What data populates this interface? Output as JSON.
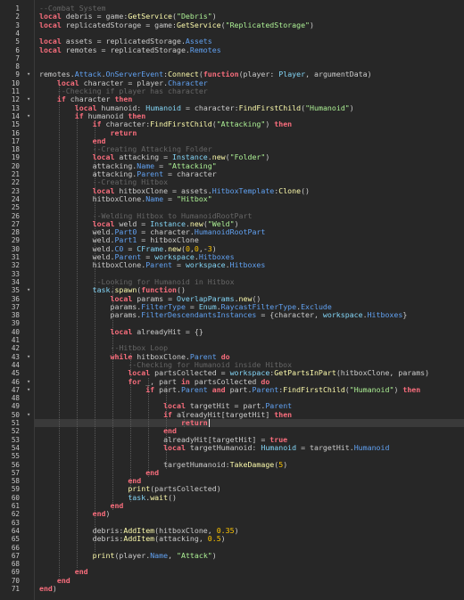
{
  "editor": {
    "line_numbers": [
      "1",
      "2",
      "3",
      "4",
      "5",
      "6",
      "7",
      "8",
      "9",
      "10",
      "11",
      "12",
      "13",
      "14",
      "15",
      "16",
      "17",
      "18",
      "19",
      "20",
      "21",
      "22",
      "23",
      "24",
      "25",
      "26",
      "27",
      "28",
      "29",
      "30",
      "31",
      "32",
      "33",
      "34",
      "35",
      "36",
      "37",
      "38",
      "39",
      "40",
      "41",
      "42",
      "43",
      "44",
      "45",
      "46",
      "47",
      "48",
      "49",
      "50",
      "51",
      "52",
      "53",
      "54",
      "55",
      "56",
      "57",
      "58",
      "59",
      "60",
      "61",
      "62",
      "63",
      "64",
      "65",
      "66",
      "67",
      "68",
      "69",
      "70",
      "71"
    ],
    "fold_glyph": "▾",
    "fold_lines": [
      9,
      12,
      14,
      35,
      43,
      46,
      47,
      50
    ],
    "current_line": 51,
    "colors": {
      "background": "#272727",
      "keyword": "#f86d7c",
      "function": "#fdfbac",
      "string": "#adf195",
      "number": "#ffc600",
      "comment": "#666666",
      "property": "#61a1f1",
      "builtin": "#84d6f7",
      "text": "#cccccc",
      "current_line": "#3a3a3a"
    },
    "lines": [
      [
        [
          "cm",
          "--Combat System"
        ]
      ],
      [
        [
          "kw",
          "local"
        ],
        [
          "id",
          " debris = game:"
        ],
        [
          "fn",
          "GetService"
        ],
        [
          "id",
          "("
        ],
        [
          "str",
          "\"Debris\""
        ],
        [
          "id",
          ")"
        ]
      ],
      [
        [
          "kw",
          "local"
        ],
        [
          "id",
          " replicatedStorage = game:"
        ],
        [
          "fn",
          "GetService"
        ],
        [
          "id",
          "("
        ],
        [
          "str",
          "\"ReplicatedStorage\""
        ],
        [
          "id",
          ")"
        ]
      ],
      [],
      [
        [
          "kw",
          "local"
        ],
        [
          "id",
          " assets = replicatedStorage."
        ],
        [
          "prop",
          "Assets"
        ]
      ],
      [
        [
          "kw",
          "local"
        ],
        [
          "id",
          " remotes = replicatedStorage."
        ],
        [
          "prop",
          "Remotes"
        ]
      ],
      [],
      [],
      [
        [
          "id",
          "remotes."
        ],
        [
          "prop",
          "Attack"
        ],
        [
          "id",
          "."
        ],
        [
          "prop",
          "OnServerEvent"
        ],
        [
          "id",
          ":"
        ],
        [
          "fn",
          "Connect"
        ],
        [
          "id",
          "("
        ],
        [
          "kw",
          "function"
        ],
        [
          "id",
          "(player: "
        ],
        [
          "bi",
          "Player"
        ],
        [
          "id",
          ", argumentData)"
        ]
      ],
      [
        [
          "id",
          "    "
        ],
        [
          "kw",
          "local"
        ],
        [
          "id",
          " character = player."
        ],
        [
          "prop",
          "Character"
        ]
      ],
      [
        [
          "id",
          "    "
        ],
        [
          "cm",
          "--Checking if player has character"
        ]
      ],
      [
        [
          "id",
          "    "
        ],
        [
          "kw",
          "if"
        ],
        [
          "id",
          " character "
        ],
        [
          "kw",
          "then"
        ]
      ],
      [
        [
          "id",
          "        "
        ],
        [
          "kw",
          "local"
        ],
        [
          "id",
          " humanoid: "
        ],
        [
          "bi",
          "Humanoid"
        ],
        [
          "id",
          " = character:"
        ],
        [
          "fn",
          "FindFirstChild"
        ],
        [
          "id",
          "("
        ],
        [
          "str",
          "\"Humanoid\""
        ],
        [
          "id",
          ")"
        ]
      ],
      [
        [
          "id",
          "        "
        ],
        [
          "kw",
          "if"
        ],
        [
          "id",
          " humanoid "
        ],
        [
          "kw",
          "then"
        ]
      ],
      [
        [
          "id",
          "            "
        ],
        [
          "kw",
          "if"
        ],
        [
          "id",
          " character:"
        ],
        [
          "fn",
          "FindFirstChild"
        ],
        [
          "id",
          "("
        ],
        [
          "str",
          "\"Attacking\""
        ],
        [
          "id",
          ") "
        ],
        [
          "kw",
          "then"
        ]
      ],
      [
        [
          "id",
          "                "
        ],
        [
          "kw",
          "return"
        ]
      ],
      [
        [
          "id",
          "            "
        ],
        [
          "kw",
          "end"
        ]
      ],
      [
        [
          "id",
          "            "
        ],
        [
          "cm",
          "--Creating Attacking Folder"
        ]
      ],
      [
        [
          "id",
          "            "
        ],
        [
          "kw",
          "local"
        ],
        [
          "id",
          " attacking = "
        ],
        [
          "bi",
          "Instance"
        ],
        [
          "id",
          "."
        ],
        [
          "fn",
          "new"
        ],
        [
          "id",
          "("
        ],
        [
          "str",
          "\"Folder\""
        ],
        [
          "id",
          ")"
        ]
      ],
      [
        [
          "id",
          "            attacking."
        ],
        [
          "prop",
          "Name"
        ],
        [
          "id",
          " = "
        ],
        [
          "str",
          "\"Attacking\""
        ]
      ],
      [
        [
          "id",
          "            attacking."
        ],
        [
          "prop",
          "Parent"
        ],
        [
          "id",
          " = character"
        ]
      ],
      [
        [
          "id",
          "            "
        ],
        [
          "cm",
          "--Creating Hitbox"
        ]
      ],
      [
        [
          "id",
          "            "
        ],
        [
          "kw",
          "local"
        ],
        [
          "id",
          " hitboxClone = assets."
        ],
        [
          "prop",
          "HitboxTemplate"
        ],
        [
          "id",
          ":"
        ],
        [
          "fn",
          "Clone"
        ],
        [
          "id",
          "()"
        ]
      ],
      [
        [
          "id",
          "            hitboxClone."
        ],
        [
          "prop",
          "Name"
        ],
        [
          "id",
          " = "
        ],
        [
          "str",
          "\"Hitbox\""
        ]
      ],
      [],
      [
        [
          "id",
          "            "
        ],
        [
          "cm",
          "--Welding Hitbox to HumanoidRootPart"
        ]
      ],
      [
        [
          "id",
          "            "
        ],
        [
          "kw",
          "local"
        ],
        [
          "id",
          " weld = "
        ],
        [
          "bi",
          "Instance"
        ],
        [
          "id",
          "."
        ],
        [
          "fn",
          "new"
        ],
        [
          "id",
          "("
        ],
        [
          "str",
          "\"Weld\""
        ],
        [
          "id",
          ")"
        ]
      ],
      [
        [
          "id",
          "            weld."
        ],
        [
          "prop",
          "Part0"
        ],
        [
          "id",
          " = character."
        ],
        [
          "prop",
          "HumanoidRootPart"
        ]
      ],
      [
        [
          "id",
          "            weld."
        ],
        [
          "prop",
          "Part1"
        ],
        [
          "id",
          " = hitboxClone"
        ]
      ],
      [
        [
          "id",
          "            weld."
        ],
        [
          "prop",
          "C0"
        ],
        [
          "id",
          " = "
        ],
        [
          "bi",
          "CFrame"
        ],
        [
          "id",
          "."
        ],
        [
          "fn",
          "new"
        ],
        [
          "id",
          "("
        ],
        [
          "num",
          "0"
        ],
        [
          "id",
          ","
        ],
        [
          "num",
          "0"
        ],
        [
          "id",
          ",-"
        ],
        [
          "num",
          "3"
        ],
        [
          "id",
          ")"
        ]
      ],
      [
        [
          "id",
          "            weld."
        ],
        [
          "prop",
          "Parent"
        ],
        [
          "id",
          " = "
        ],
        [
          "bi",
          "workspace"
        ],
        [
          "id",
          "."
        ],
        [
          "prop",
          "Hitboxes"
        ]
      ],
      [
        [
          "id",
          "            hitboxClone."
        ],
        [
          "prop",
          "Parent"
        ],
        [
          "id",
          " = "
        ],
        [
          "bi",
          "workspace"
        ],
        [
          "id",
          "."
        ],
        [
          "prop",
          "Hitboxes"
        ]
      ],
      [],
      [
        [
          "id",
          "            "
        ],
        [
          "cm",
          "--Looking for Humanoid in Hitbox"
        ]
      ],
      [
        [
          "id",
          "            "
        ],
        [
          "bi",
          "task"
        ],
        [
          "id",
          "."
        ],
        [
          "fn",
          "spawn"
        ],
        [
          "id",
          "("
        ],
        [
          "kw",
          "function"
        ],
        [
          "id",
          "()"
        ]
      ],
      [
        [
          "id",
          "                "
        ],
        [
          "kw",
          "local"
        ],
        [
          "id",
          " params = "
        ],
        [
          "bi",
          "OverlapParams"
        ],
        [
          "id",
          "."
        ],
        [
          "fn",
          "new"
        ],
        [
          "id",
          "()"
        ]
      ],
      [
        [
          "id",
          "                params."
        ],
        [
          "prop",
          "FilterType"
        ],
        [
          "id",
          " = "
        ],
        [
          "bi",
          "Enum"
        ],
        [
          "id",
          "."
        ],
        [
          "prop",
          "RaycastFilterType"
        ],
        [
          "id",
          "."
        ],
        [
          "prop",
          "Exclude"
        ]
      ],
      [
        [
          "id",
          "                params."
        ],
        [
          "prop",
          "FilterDescendantsInstances"
        ],
        [
          "id",
          " = {character, "
        ],
        [
          "bi",
          "workspace"
        ],
        [
          "id",
          "."
        ],
        [
          "prop",
          "Hitboxes"
        ],
        [
          "id",
          "}"
        ]
      ],
      [],
      [
        [
          "id",
          "                "
        ],
        [
          "kw",
          "local"
        ],
        [
          "id",
          " alreadyHit = {}"
        ]
      ],
      [],
      [
        [
          "id",
          "                "
        ],
        [
          "cm",
          "--Hitbox Loop"
        ]
      ],
      [
        [
          "id",
          "                "
        ],
        [
          "kw",
          "while"
        ],
        [
          "id",
          " hitboxClone."
        ],
        [
          "prop",
          "Parent"
        ],
        [
          "id",
          " "
        ],
        [
          "kw",
          "do"
        ]
      ],
      [
        [
          "id",
          "                    "
        ],
        [
          "cm",
          "--Checking for Humanoid inside Hitbox"
        ]
      ],
      [
        [
          "id",
          "                    "
        ],
        [
          "kw",
          "local"
        ],
        [
          "id",
          " partsCollected = "
        ],
        [
          "bi",
          "workspace"
        ],
        [
          "id",
          ":"
        ],
        [
          "fn",
          "GetPartsInPart"
        ],
        [
          "id",
          "(hitboxClone, params)"
        ]
      ],
      [
        [
          "id",
          "                    "
        ],
        [
          "kw",
          "for"
        ],
        [
          "id",
          " _, part "
        ],
        [
          "kw",
          "in"
        ],
        [
          "id",
          " partsCollected "
        ],
        [
          "kw",
          "do"
        ]
      ],
      [
        [
          "id",
          "                        "
        ],
        [
          "kw",
          "if"
        ],
        [
          "id",
          " part."
        ],
        [
          "prop",
          "Parent"
        ],
        [
          "id",
          " "
        ],
        [
          "kw",
          "and"
        ],
        [
          "id",
          " part."
        ],
        [
          "prop",
          "Parent"
        ],
        [
          "id",
          ":"
        ],
        [
          "fn",
          "FindFirstChild"
        ],
        [
          "id",
          "("
        ],
        [
          "str",
          "\"Humanoid\""
        ],
        [
          "id",
          ") "
        ],
        [
          "kw",
          "then"
        ]
      ],
      [],
      [
        [
          "id",
          "                            "
        ],
        [
          "kw",
          "local"
        ],
        [
          "id",
          " targetHit = part."
        ],
        [
          "prop",
          "Parent"
        ]
      ],
      [
        [
          "id",
          "                            "
        ],
        [
          "kw",
          "if"
        ],
        [
          "id",
          " alreadyHit[targetHit] "
        ],
        [
          "kw",
          "then"
        ]
      ],
      [
        [
          "id",
          "                                "
        ],
        [
          "kw",
          "return"
        ]
      ],
      [
        [
          "id",
          "                            "
        ],
        [
          "kw",
          "end"
        ]
      ],
      [
        [
          "id",
          "                            alreadyHit[targetHit] = "
        ],
        [
          "kw",
          "true"
        ]
      ],
      [
        [
          "id",
          "                            "
        ],
        [
          "kw",
          "local"
        ],
        [
          "id",
          " targetHumanoid: "
        ],
        [
          "bi",
          "Humanoid"
        ],
        [
          "id",
          " = targetHit."
        ],
        [
          "prop",
          "Humanoid"
        ]
      ],
      [],
      [
        [
          "id",
          "                            targetHumanoid:"
        ],
        [
          "fn",
          "TakeDamage"
        ],
        [
          "id",
          "("
        ],
        [
          "num",
          "5"
        ],
        [
          "id",
          ")"
        ]
      ],
      [
        [
          "id",
          "                        "
        ],
        [
          "kw",
          "end"
        ]
      ],
      [
        [
          "id",
          "                    "
        ],
        [
          "kw",
          "end"
        ]
      ],
      [
        [
          "id",
          "                    "
        ],
        [
          "fn",
          "print"
        ],
        [
          "id",
          "(partsCollected)"
        ]
      ],
      [
        [
          "id",
          "                    "
        ],
        [
          "bi",
          "task"
        ],
        [
          "id",
          "."
        ],
        [
          "fn",
          "wait"
        ],
        [
          "id",
          "()"
        ]
      ],
      [
        [
          "id",
          "                "
        ],
        [
          "kw",
          "end"
        ]
      ],
      [
        [
          "id",
          "            "
        ],
        [
          "kw",
          "end"
        ],
        [
          "id",
          ")"
        ]
      ],
      [],
      [
        [
          "id",
          "            debris:"
        ],
        [
          "fn",
          "AddItem"
        ],
        [
          "id",
          "(hitboxClone, "
        ],
        [
          "num",
          "0.35"
        ],
        [
          "id",
          ")"
        ]
      ],
      [
        [
          "id",
          "            debris:"
        ],
        [
          "fn",
          "AddItem"
        ],
        [
          "id",
          "(attacking, "
        ],
        [
          "num",
          "0.5"
        ],
        [
          "id",
          ")"
        ]
      ],
      [],
      [
        [
          "id",
          "            "
        ],
        [
          "fn",
          "print"
        ],
        [
          "id",
          "(player."
        ],
        [
          "prop",
          "Name"
        ],
        [
          "id",
          ", "
        ],
        [
          "str",
          "\"Attack\""
        ],
        [
          "id",
          ")"
        ]
      ],
      [],
      [
        [
          "id",
          "        "
        ],
        [
          "kw",
          "end"
        ]
      ],
      [
        [
          "id",
          "    "
        ],
        [
          "kw",
          "end"
        ]
      ],
      [
        [
          "kw",
          "end"
        ],
        [
          "id",
          ")"
        ]
      ]
    ]
  }
}
